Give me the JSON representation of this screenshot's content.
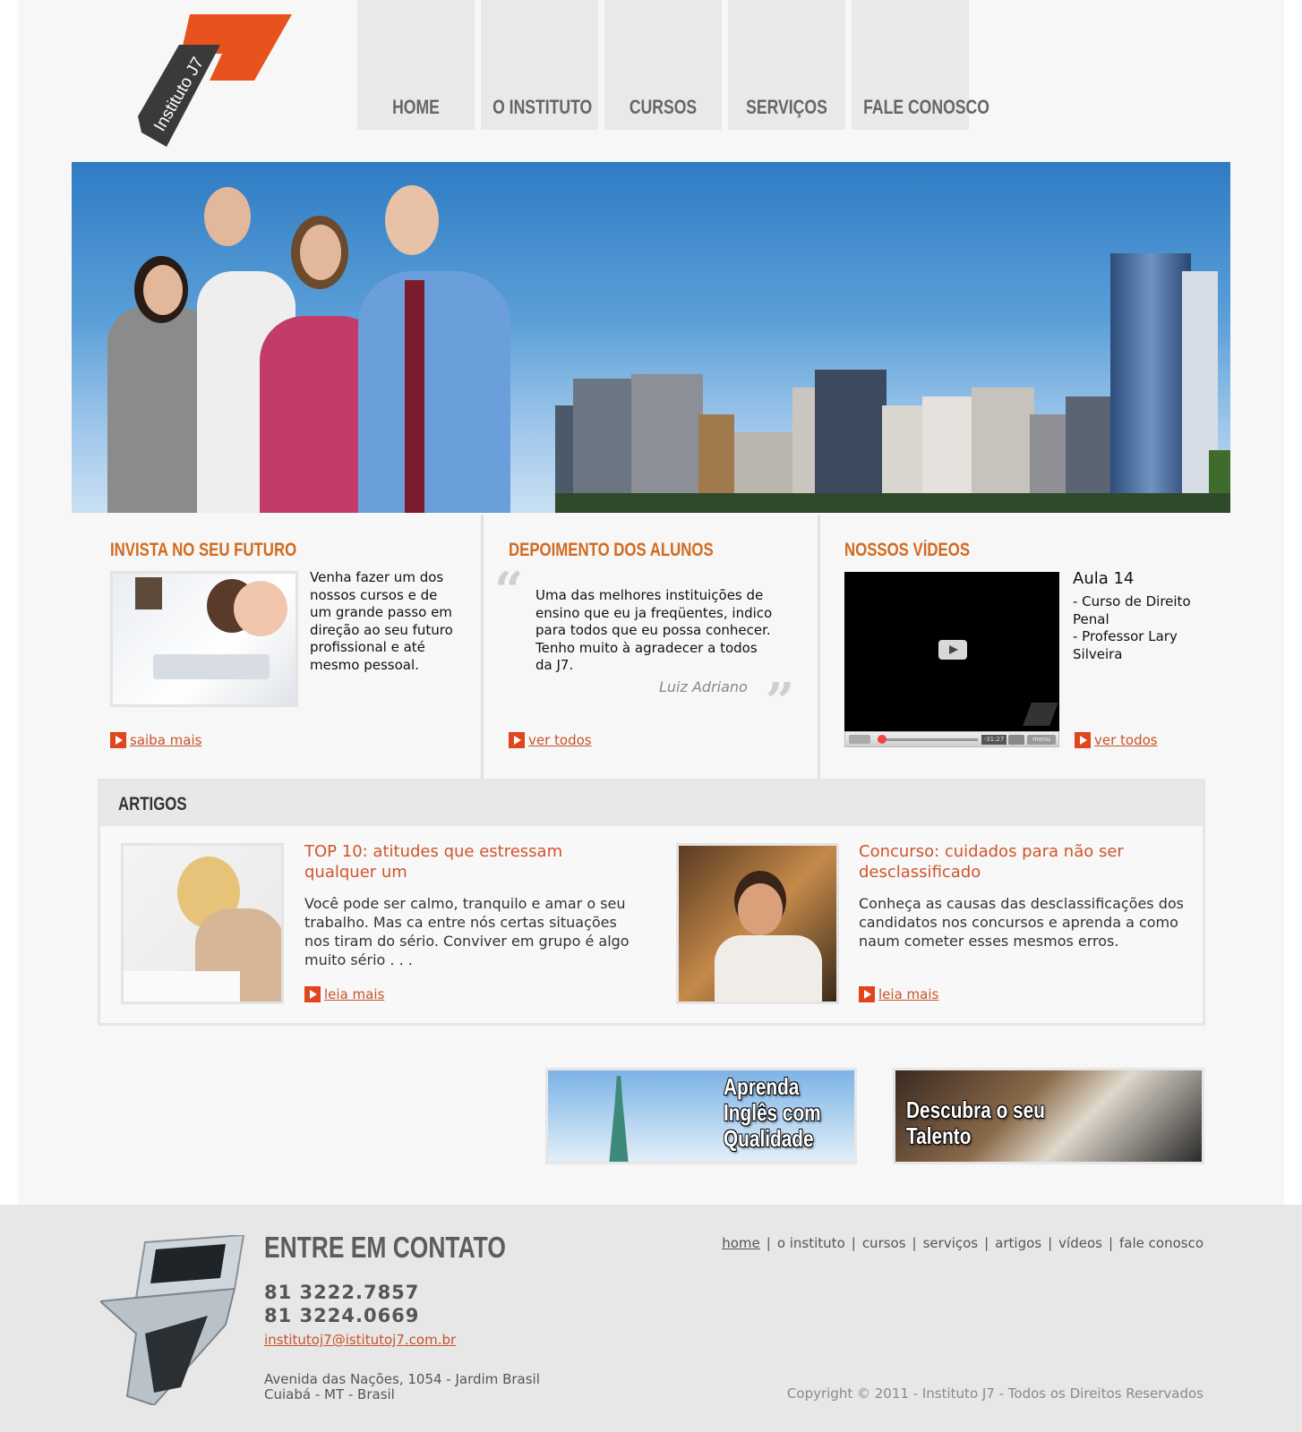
{
  "brand": {
    "logo_text": "Instituto J7",
    "accent_color": "#e8531d"
  },
  "nav": {
    "items": [
      {
        "label": "HOME"
      },
      {
        "label": "O INSTITUTO"
      },
      {
        "label": "CURSOS"
      },
      {
        "label": "SERVIÇOS"
      },
      {
        "label": "FALE CONOSCO"
      }
    ]
  },
  "hero": {
    "description_icon": "team-city-photo"
  },
  "invista": {
    "title": "INVISTA NO SEU FUTURO",
    "text": "Venha fazer um dos nossos cursos e de um grande passo em direção ao seu futuro profissional e até mesmo pessoal.",
    "more_label": "saiba mais"
  },
  "depoimento": {
    "title": "DEPOIMENTO DOS ALUNOS",
    "quote": "Uma das melhores instituições de ensino que eu ja freqüentes, indico para todos que eu possa conhecer. Tenho muito à agradecer a todos da J7.",
    "author": "Luiz Adriano",
    "more_label": "ver todos"
  },
  "videos": {
    "title": "NOSSOS VÍDEOS",
    "video_title": "Aula 14",
    "video_course": "- Curso de Direito Penal",
    "video_professor": "- Professor Lary Silveira",
    "time_label": "-31:27",
    "menu_label": "menu",
    "more_label": "ver todos"
  },
  "artigos": {
    "heading": "ARTIGOS",
    "items": [
      {
        "title": "TOP 10: atitudes que estressam qualquer um",
        "text": "Você pode ser calmo, tranquilo e amar o seu trabalho. Mas ca entre nós certas situações nos tiram do sério. Conviver em grupo é algo muito sério . . .",
        "more_label": "leia mais"
      },
      {
        "title": "Concurso: cuidados para não ser desclassificado",
        "text": "Conheça as  causas das desclassificações dos candidatos nos concursos e aprenda a como naum cometer esses mesmos erros.",
        "more_label": "leia mais"
      }
    ]
  },
  "banners": [
    {
      "line1": "Aprenda",
      "line2": "Inglês com",
      "line3": "Qualidade"
    },
    {
      "line1": "Descubra o seu",
      "line2": "Talento"
    }
  ],
  "footer": {
    "contact_title": "ENTRE EM CONTATO",
    "phone1": "81 3222.7857",
    "phone2": "81 3224.0669",
    "email": "institutoj7@istitutoj7.com.br",
    "address1": "Avenida das Nações, 1054 - Jardim Brasil",
    "address2": "Cuiabá - MT - Brasil",
    "nav": [
      {
        "label": "home"
      },
      {
        "label": "o instituto"
      },
      {
        "label": "cursos"
      },
      {
        "label": "serviços"
      },
      {
        "label": "artigos"
      },
      {
        "label": "vídeos"
      },
      {
        "label": "fale conosco"
      }
    ],
    "copyright": "Copyright © 2011 - Instituto J7 - Todos os Direitos Reservados"
  }
}
